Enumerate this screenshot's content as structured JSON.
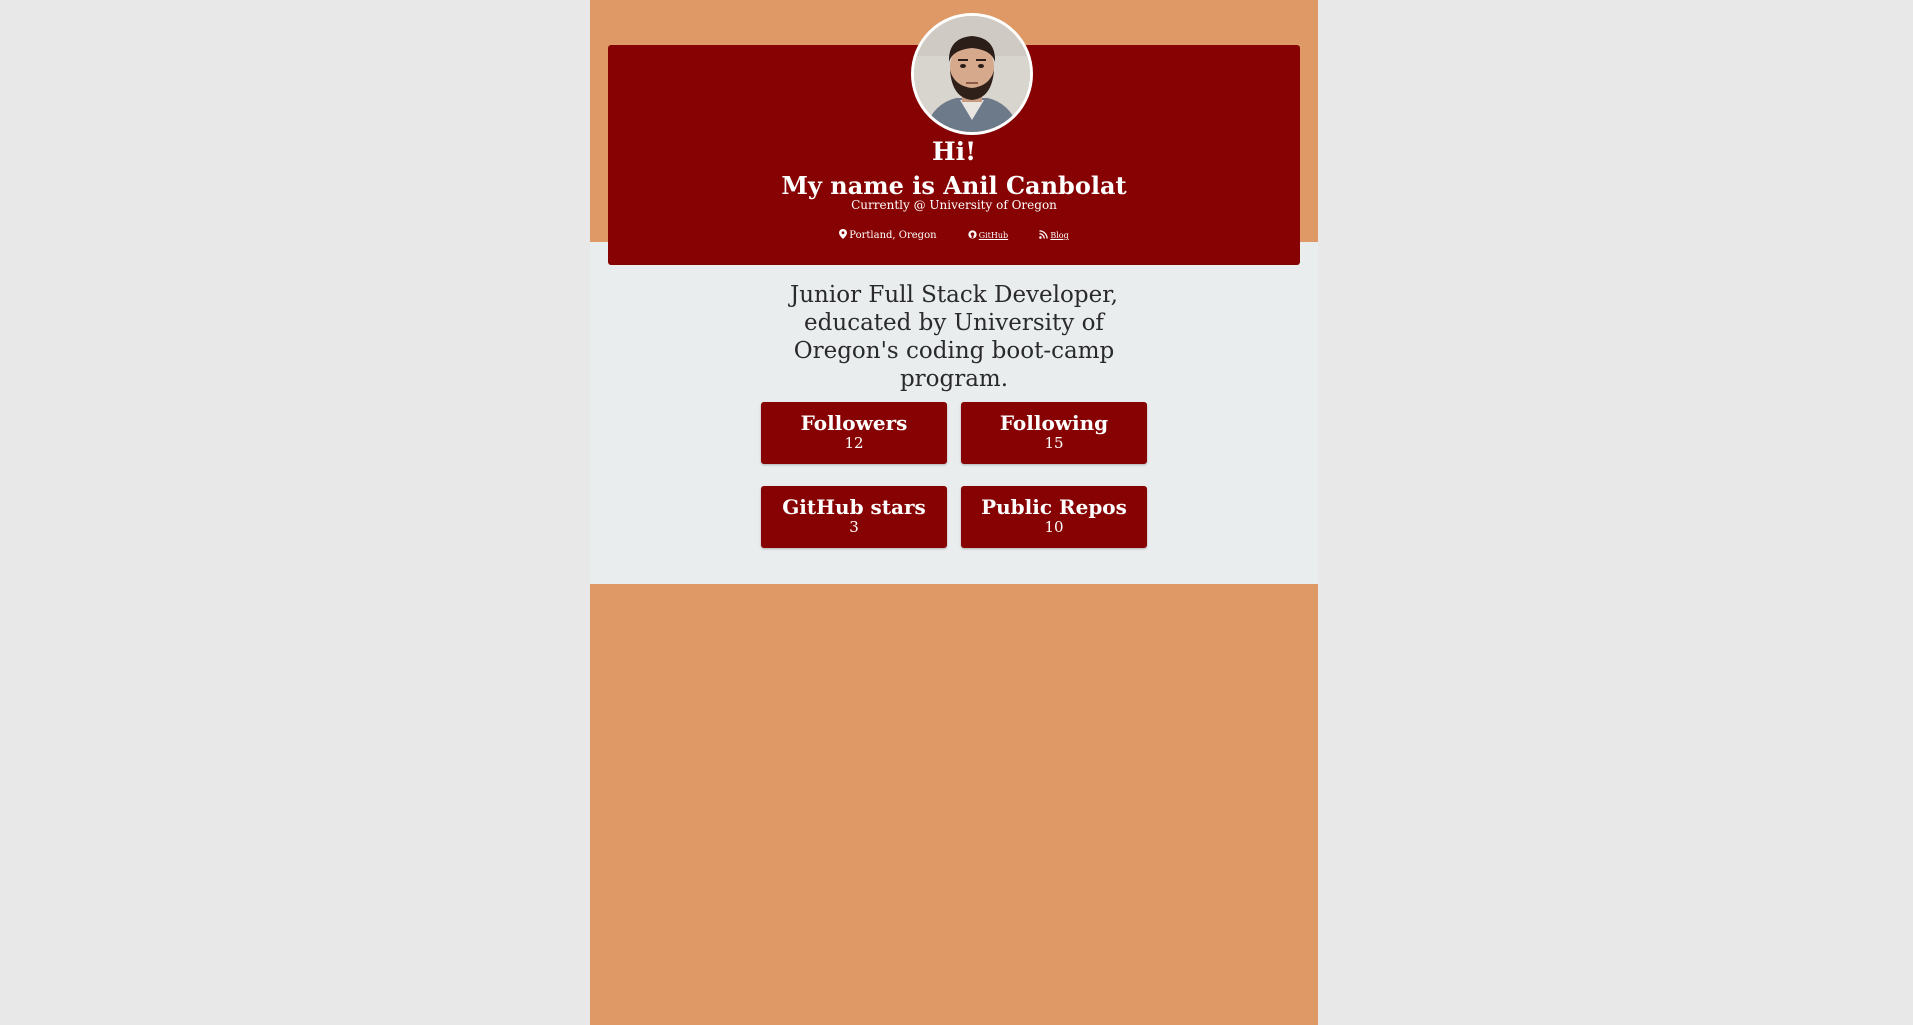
{
  "header": {
    "greeting": "Hi!",
    "name_line": "My name is Anil Canbolat",
    "current": "Currently @ University of Oregon",
    "location": "Portland, Oregon",
    "github_label": "GitHub",
    "blog_label": "Blog",
    "avatar_icon": "profile-photo"
  },
  "bio": "Junior Full Stack Developer, educated by University of Oregon's coding boot-camp program.",
  "stats": {
    "followers": {
      "label": "Followers",
      "value": "12"
    },
    "following": {
      "label": "Following",
      "value": "15"
    },
    "stars": {
      "label": "GitHub stars",
      "value": "3"
    },
    "repos": {
      "label": "Public Repos",
      "value": "10"
    }
  },
  "colors": {
    "accent": "#870303",
    "page_bg": "#df9966",
    "content_bg": "#e9edee",
    "outer_bg": "#e8e8e8"
  }
}
